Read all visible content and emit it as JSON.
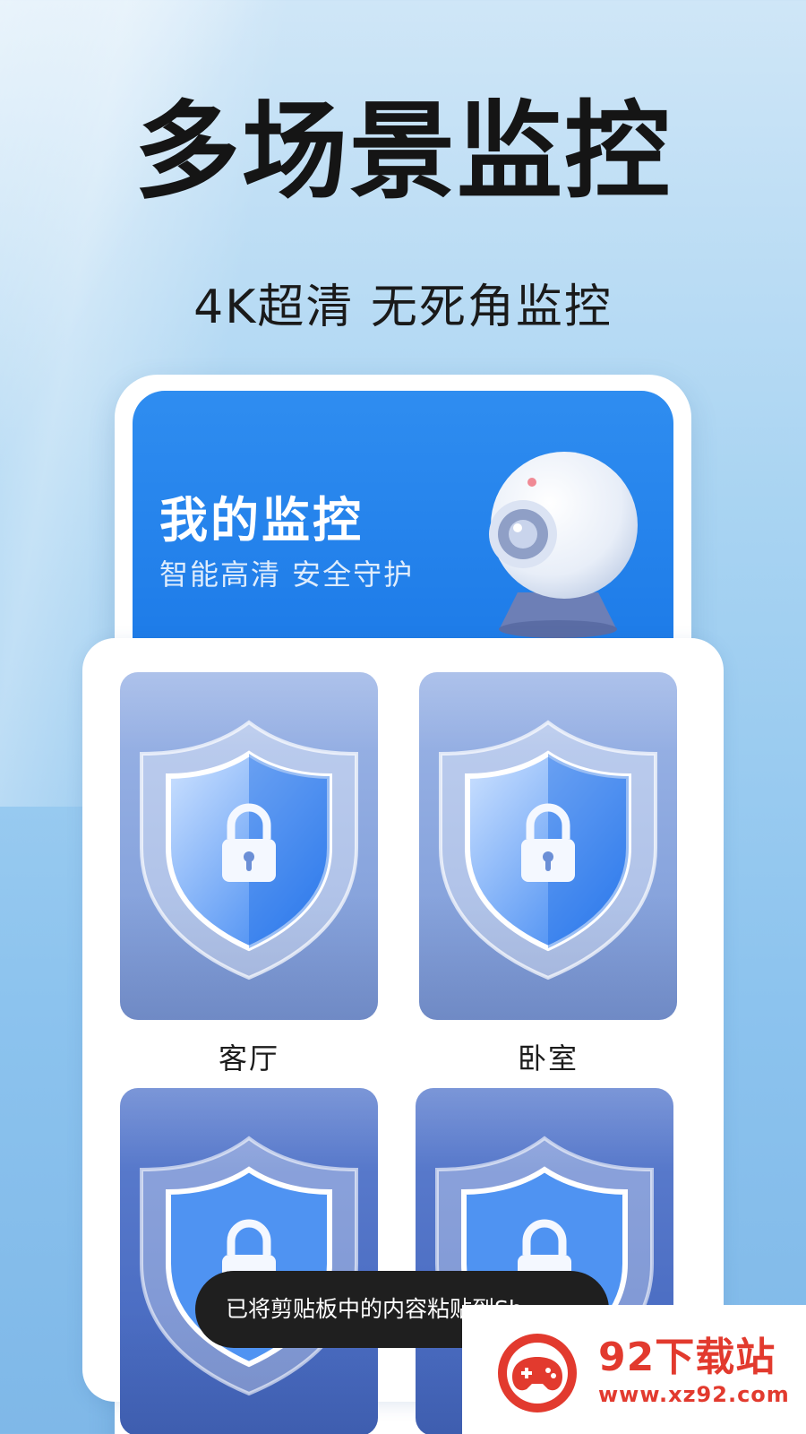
{
  "hero": {
    "title": "多场景监控",
    "subtitle": "4K超清 无死角监控"
  },
  "banner": {
    "title": "我的监控",
    "subtitle": "智能高清 安全守护",
    "accent": "#1d7be8"
  },
  "rooms": [
    {
      "label": "客厅"
    },
    {
      "label": "卧室"
    },
    {
      "label": ""
    },
    {
      "label": ""
    }
  ],
  "toast": {
    "text": "已将剪贴板中的内容粘贴到Sh..."
  },
  "watermark": {
    "name": "92下载站",
    "url": "www.xz92.com",
    "color": "#e23a2e"
  }
}
